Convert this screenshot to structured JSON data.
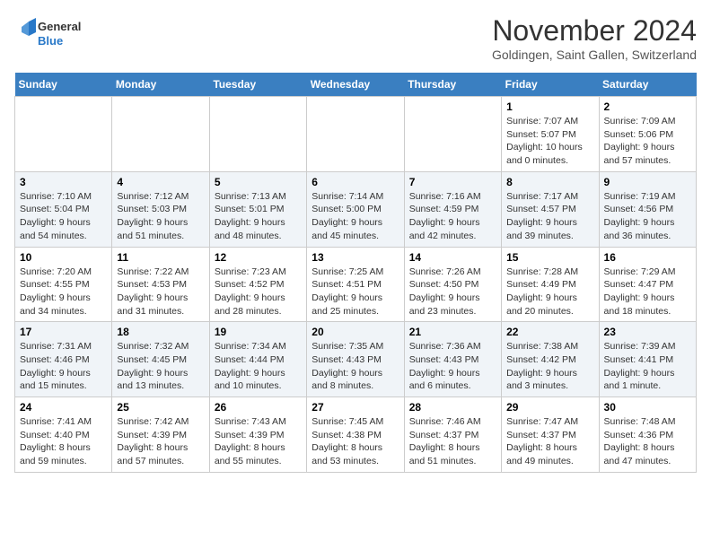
{
  "logo": {
    "text1": "General",
    "text2": "Blue"
  },
  "title": "November 2024",
  "subtitle": "Goldingen, Saint Gallen, Switzerland",
  "days_of_week": [
    "Sunday",
    "Monday",
    "Tuesday",
    "Wednesday",
    "Thursday",
    "Friday",
    "Saturday"
  ],
  "weeks": [
    [
      {
        "day": "",
        "info": ""
      },
      {
        "day": "",
        "info": ""
      },
      {
        "day": "",
        "info": ""
      },
      {
        "day": "",
        "info": ""
      },
      {
        "day": "",
        "info": ""
      },
      {
        "day": "1",
        "info": "Sunrise: 7:07 AM\nSunset: 5:07 PM\nDaylight: 10 hours and 0 minutes."
      },
      {
        "day": "2",
        "info": "Sunrise: 7:09 AM\nSunset: 5:06 PM\nDaylight: 9 hours and 57 minutes."
      }
    ],
    [
      {
        "day": "3",
        "info": "Sunrise: 7:10 AM\nSunset: 5:04 PM\nDaylight: 9 hours and 54 minutes."
      },
      {
        "day": "4",
        "info": "Sunrise: 7:12 AM\nSunset: 5:03 PM\nDaylight: 9 hours and 51 minutes."
      },
      {
        "day": "5",
        "info": "Sunrise: 7:13 AM\nSunset: 5:01 PM\nDaylight: 9 hours and 48 minutes."
      },
      {
        "day": "6",
        "info": "Sunrise: 7:14 AM\nSunset: 5:00 PM\nDaylight: 9 hours and 45 minutes."
      },
      {
        "day": "7",
        "info": "Sunrise: 7:16 AM\nSunset: 4:59 PM\nDaylight: 9 hours and 42 minutes."
      },
      {
        "day": "8",
        "info": "Sunrise: 7:17 AM\nSunset: 4:57 PM\nDaylight: 9 hours and 39 minutes."
      },
      {
        "day": "9",
        "info": "Sunrise: 7:19 AM\nSunset: 4:56 PM\nDaylight: 9 hours and 36 minutes."
      }
    ],
    [
      {
        "day": "10",
        "info": "Sunrise: 7:20 AM\nSunset: 4:55 PM\nDaylight: 9 hours and 34 minutes."
      },
      {
        "day": "11",
        "info": "Sunrise: 7:22 AM\nSunset: 4:53 PM\nDaylight: 9 hours and 31 minutes."
      },
      {
        "day": "12",
        "info": "Sunrise: 7:23 AM\nSunset: 4:52 PM\nDaylight: 9 hours and 28 minutes."
      },
      {
        "day": "13",
        "info": "Sunrise: 7:25 AM\nSunset: 4:51 PM\nDaylight: 9 hours and 25 minutes."
      },
      {
        "day": "14",
        "info": "Sunrise: 7:26 AM\nSunset: 4:50 PM\nDaylight: 9 hours and 23 minutes."
      },
      {
        "day": "15",
        "info": "Sunrise: 7:28 AM\nSunset: 4:49 PM\nDaylight: 9 hours and 20 minutes."
      },
      {
        "day": "16",
        "info": "Sunrise: 7:29 AM\nSunset: 4:47 PM\nDaylight: 9 hours and 18 minutes."
      }
    ],
    [
      {
        "day": "17",
        "info": "Sunrise: 7:31 AM\nSunset: 4:46 PM\nDaylight: 9 hours and 15 minutes."
      },
      {
        "day": "18",
        "info": "Sunrise: 7:32 AM\nSunset: 4:45 PM\nDaylight: 9 hours and 13 minutes."
      },
      {
        "day": "19",
        "info": "Sunrise: 7:34 AM\nSunset: 4:44 PM\nDaylight: 9 hours and 10 minutes."
      },
      {
        "day": "20",
        "info": "Sunrise: 7:35 AM\nSunset: 4:43 PM\nDaylight: 9 hours and 8 minutes."
      },
      {
        "day": "21",
        "info": "Sunrise: 7:36 AM\nSunset: 4:43 PM\nDaylight: 9 hours and 6 minutes."
      },
      {
        "day": "22",
        "info": "Sunrise: 7:38 AM\nSunset: 4:42 PM\nDaylight: 9 hours and 3 minutes."
      },
      {
        "day": "23",
        "info": "Sunrise: 7:39 AM\nSunset: 4:41 PM\nDaylight: 9 hours and 1 minute."
      }
    ],
    [
      {
        "day": "24",
        "info": "Sunrise: 7:41 AM\nSunset: 4:40 PM\nDaylight: 8 hours and 59 minutes."
      },
      {
        "day": "25",
        "info": "Sunrise: 7:42 AM\nSunset: 4:39 PM\nDaylight: 8 hours and 57 minutes."
      },
      {
        "day": "26",
        "info": "Sunrise: 7:43 AM\nSunset: 4:39 PM\nDaylight: 8 hours and 55 minutes."
      },
      {
        "day": "27",
        "info": "Sunrise: 7:45 AM\nSunset: 4:38 PM\nDaylight: 8 hours and 53 minutes."
      },
      {
        "day": "28",
        "info": "Sunrise: 7:46 AM\nSunset: 4:37 PM\nDaylight: 8 hours and 51 minutes."
      },
      {
        "day": "29",
        "info": "Sunrise: 7:47 AM\nSunset: 4:37 PM\nDaylight: 8 hours and 49 minutes."
      },
      {
        "day": "30",
        "info": "Sunrise: 7:48 AM\nSunset: 4:36 PM\nDaylight: 8 hours and 47 minutes."
      }
    ]
  ]
}
